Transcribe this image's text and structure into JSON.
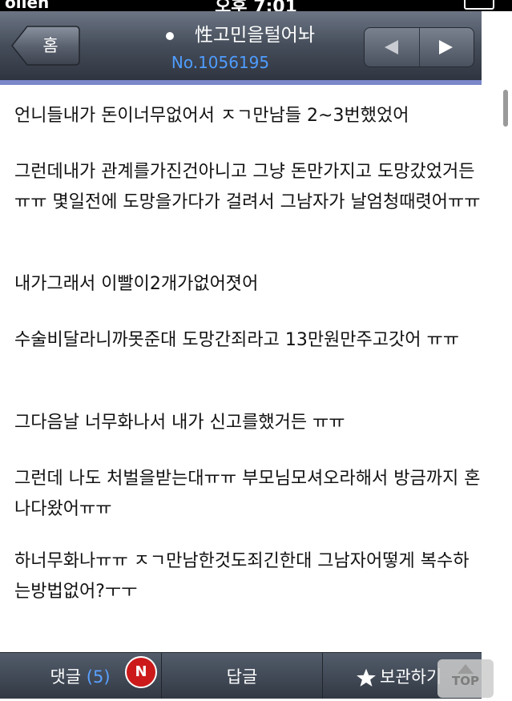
{
  "status_bar": {
    "carrier": "olleh",
    "time": "오후 7:01"
  },
  "header": {
    "home_label": "홈",
    "title": "性고민을털어놔",
    "post_number": "No.1056195"
  },
  "post": {
    "paragraphs": [
      "언니들내가 돈이너무없어서 ㅈㄱ만남들 2~3번했었어",
      "그런데내가 관계를가진건아니고 그냥 돈만가지고 도망갔었거든 ㅠㅠ 몇일전에 도망을가다가 걸려서 그남자가 날엄청때렷어ㅠㅠ",
      "내가그래서 이빨이2개가없어졋어",
      "수술비달라니까못준대 도망간죄라고 13만원만주고갓어 ㅠㅠ",
      "그다음날 너무화나서 내가 신고를했거든 ㅠㅠ",
      "그런데 나도 처벌을받는대ㅠㅠ 부모님모셔오라해서 방금까지 혼나다왔어ㅠㅠ",
      "하너무화나ㅠㅠ ㅈㄱ만남한것도죄긴한대 그남자어떻게 복수하는방법없어?ㅜㅜ"
    ]
  },
  "toolbar": {
    "comments_label": "댓글",
    "comments_count": "(5)",
    "new_badge": "N",
    "reply_label": "답글",
    "save_label": "보관하기",
    "top_label": "TOP"
  },
  "colors": {
    "accent_line": "#7a87c9",
    "link_blue": "#4f9dff",
    "badge_red": "#cc1a1a"
  },
  "icons": [
    "back-arrow-icon",
    "prev-arrow-icon",
    "next-arrow-icon",
    "star-icon",
    "up-arrow-icon",
    "signal-icon",
    "battery-icon"
  ]
}
